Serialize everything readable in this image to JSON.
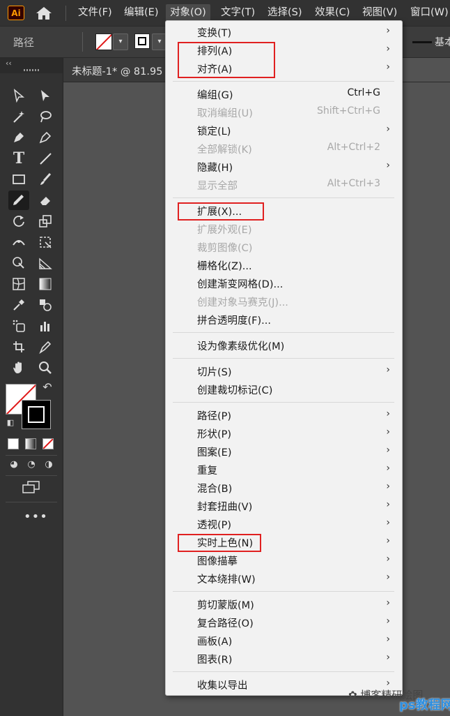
{
  "app": {
    "logo": "Ai"
  },
  "menubar": {
    "items": [
      "文件(F)",
      "编辑(E)",
      "对象(O)",
      "文字(T)",
      "选择(S)",
      "效果(C)",
      "视图(V)",
      "窗口(W)"
    ],
    "active": "对象(O)"
  },
  "controlbar": {
    "selection_label": "路径",
    "fill_color": "none",
    "stroke_color": "#000000",
    "style_label": "基本"
  },
  "document": {
    "tab_title": "未标题-1* @ 81.95"
  },
  "object_menu": {
    "groups": [
      [
        {
          "label": "变换(T)",
          "shortcut": "",
          "submenu": true,
          "disabled": false
        },
        {
          "label": "排列(A)",
          "shortcut": "",
          "submenu": true,
          "disabled": false
        },
        {
          "label": "对齐(A)",
          "shortcut": "",
          "submenu": true,
          "disabled": false
        }
      ],
      [
        {
          "label": "编组(G)",
          "shortcut": "Ctrl+G",
          "submenu": false,
          "disabled": false
        },
        {
          "label": "取消编组(U)",
          "shortcut": "Shift+Ctrl+G",
          "submenu": false,
          "disabled": true
        },
        {
          "label": "锁定(L)",
          "shortcut": "",
          "submenu": true,
          "disabled": false
        },
        {
          "label": "全部解锁(K)",
          "shortcut": "Alt+Ctrl+2",
          "submenu": false,
          "disabled": true
        },
        {
          "label": "隐藏(H)",
          "shortcut": "",
          "submenu": true,
          "disabled": false
        },
        {
          "label": "显示全部",
          "shortcut": "Alt+Ctrl+3",
          "submenu": false,
          "disabled": true
        }
      ],
      [
        {
          "label": "扩展(X)...",
          "shortcut": "",
          "submenu": false,
          "disabled": false
        },
        {
          "label": "扩展外观(E)",
          "shortcut": "",
          "submenu": false,
          "disabled": true
        },
        {
          "label": "裁剪图像(C)",
          "shortcut": "",
          "submenu": false,
          "disabled": true
        },
        {
          "label": "栅格化(Z)...",
          "shortcut": "",
          "submenu": false,
          "disabled": false
        },
        {
          "label": "创建渐变网格(D)...",
          "shortcut": "",
          "submenu": false,
          "disabled": false
        },
        {
          "label": "创建对象马赛克(J)...",
          "shortcut": "",
          "submenu": false,
          "disabled": true
        },
        {
          "label": "拼合透明度(F)...",
          "shortcut": "",
          "submenu": false,
          "disabled": false
        }
      ],
      [
        {
          "label": "设为像素级优化(M)",
          "shortcut": "",
          "submenu": false,
          "disabled": false
        }
      ],
      [
        {
          "label": "切片(S)",
          "shortcut": "",
          "submenu": true,
          "disabled": false
        },
        {
          "label": "创建裁切标记(C)",
          "shortcut": "",
          "submenu": false,
          "disabled": false
        }
      ],
      [
        {
          "label": "路径(P)",
          "shortcut": "",
          "submenu": true,
          "disabled": false
        },
        {
          "label": "形状(P)",
          "shortcut": "",
          "submenu": true,
          "disabled": false
        },
        {
          "label": "图案(E)",
          "shortcut": "",
          "submenu": true,
          "disabled": false
        },
        {
          "label": "重复",
          "shortcut": "",
          "submenu": true,
          "disabled": false
        },
        {
          "label": "混合(B)",
          "shortcut": "",
          "submenu": true,
          "disabled": false
        },
        {
          "label": "封套扭曲(V)",
          "shortcut": "",
          "submenu": true,
          "disabled": false
        },
        {
          "label": "透视(P)",
          "shortcut": "",
          "submenu": true,
          "disabled": false
        },
        {
          "label": "实时上色(N)",
          "shortcut": "",
          "submenu": true,
          "disabled": false
        },
        {
          "label": "图像描摹",
          "shortcut": "",
          "submenu": true,
          "disabled": false
        },
        {
          "label": "文本绕排(W)",
          "shortcut": "",
          "submenu": true,
          "disabled": false
        }
      ],
      [
        {
          "label": "剪切蒙版(M)",
          "shortcut": "",
          "submenu": true,
          "disabled": false
        },
        {
          "label": "复合路径(O)",
          "shortcut": "",
          "submenu": true,
          "disabled": false
        },
        {
          "label": "画板(A)",
          "shortcut": "",
          "submenu": true,
          "disabled": false
        },
        {
          "label": "图表(R)",
          "shortcut": "",
          "submenu": true,
          "disabled": false
        }
      ],
      [
        {
          "label": "收集以导出",
          "shortcut": "",
          "submenu": true,
          "disabled": false
        }
      ]
    ],
    "highlighted": [
      "排列(A)",
      "对齐(A)",
      "扩展(X)...",
      "实时上色(N)"
    ]
  },
  "submenu_arrow": "›",
  "colors": {
    "highlight_box": "#e02020",
    "accent": "#ff9a00"
  },
  "watermark": {
    "text": "博客精研绘图",
    "brand": "ps教程网"
  }
}
